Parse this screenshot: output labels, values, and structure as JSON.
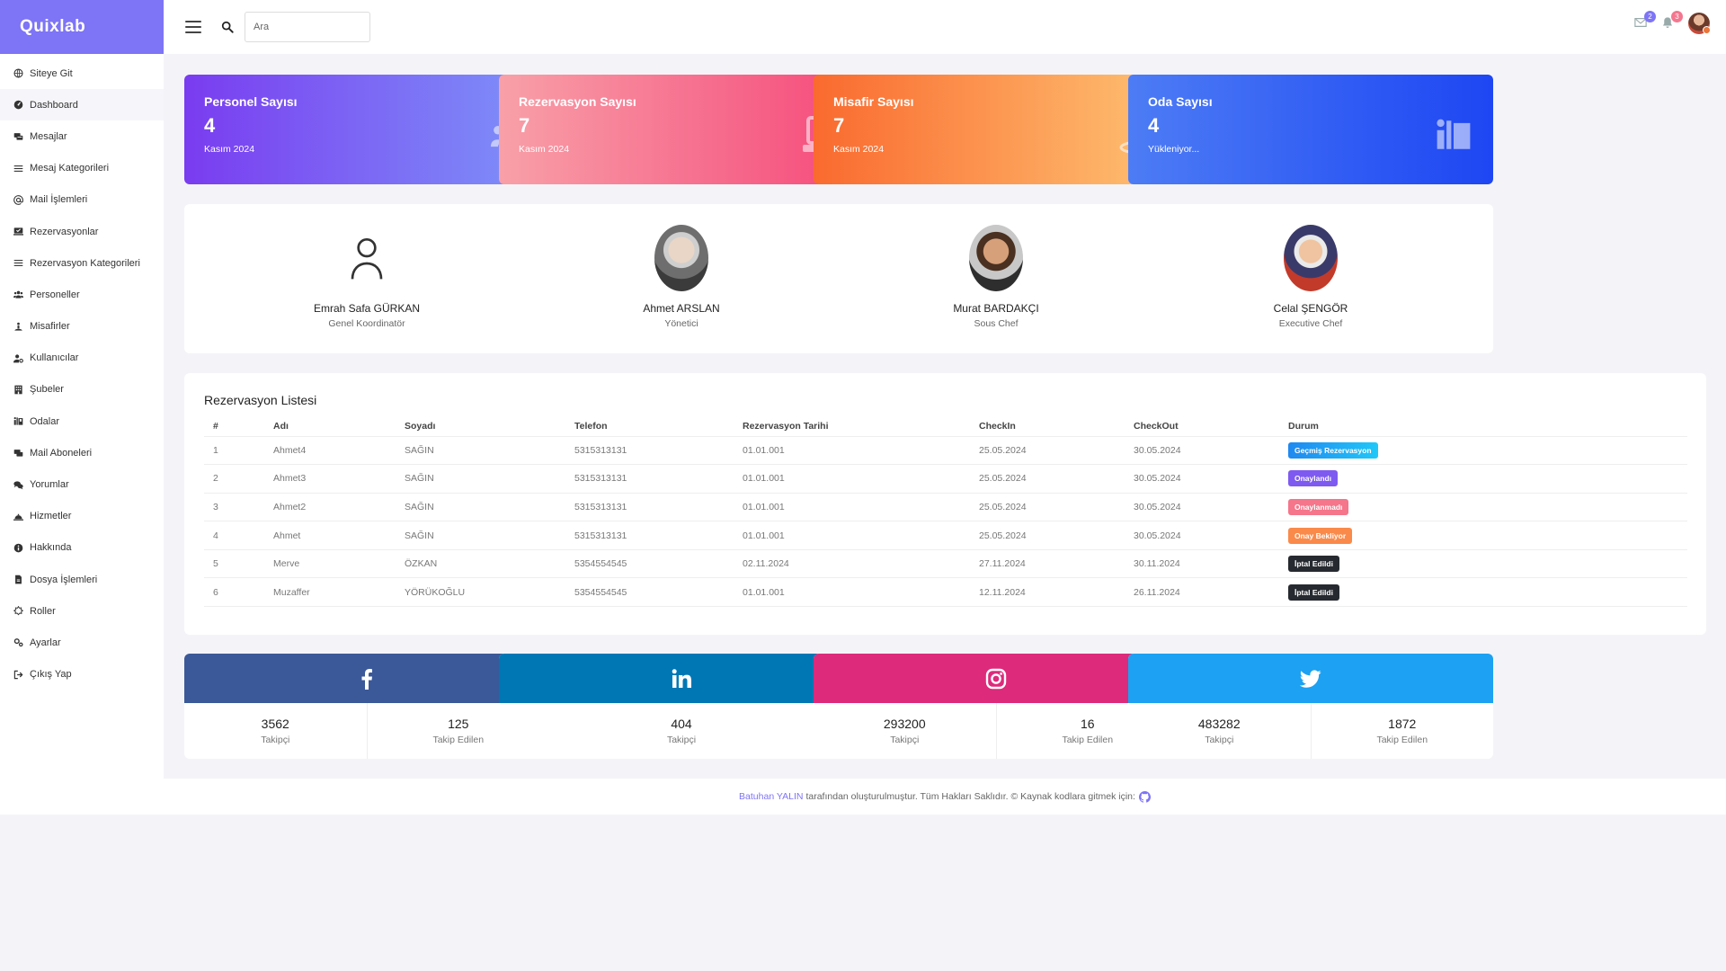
{
  "brand": "Quixlab",
  "search": {
    "placeholder": "Ara"
  },
  "header": {
    "mail_badge": "2",
    "notif_badge": "3",
    "colors": {
      "mail_badge": "#7e74f6",
      "notif_badge": "#f4778f"
    }
  },
  "sidebar": {
    "items": [
      {
        "label": "Siteye Git",
        "icon": "globe-icon"
      },
      {
        "label": "Dashboard",
        "icon": "dashboard-icon"
      },
      {
        "label": "Mesajlar",
        "icon": "messages-icon"
      },
      {
        "label": "Mesaj Kategorileri",
        "icon": "list-icon"
      },
      {
        "label": "Mail İşlemleri",
        "icon": "at-icon"
      },
      {
        "label": "Rezervasyonlar",
        "icon": "reservation-icon"
      },
      {
        "label": "Rezervasyon Kategorileri",
        "icon": "list-icon"
      },
      {
        "label": "Personeller",
        "icon": "users-icon"
      },
      {
        "label": "Misafirler",
        "icon": "guest-icon"
      },
      {
        "label": "Kullanıcılar",
        "icon": "user-cog-icon"
      },
      {
        "label": "Şubeler",
        "icon": "building-icon"
      },
      {
        "label": "Odalar",
        "icon": "room-icon"
      },
      {
        "label": "Mail Aboneleri",
        "icon": "subscribers-icon"
      },
      {
        "label": "Yorumlar",
        "icon": "comments-icon"
      },
      {
        "label": "Hizmetler",
        "icon": "services-icon"
      },
      {
        "label": "Hakkında",
        "icon": "info-icon"
      },
      {
        "label": "Dosya İşlemleri",
        "icon": "file-icon"
      },
      {
        "label": "Roller",
        "icon": "roles-icon"
      },
      {
        "label": "Ayarlar",
        "icon": "cogs-icon"
      },
      {
        "label": "Çıkış Yap",
        "icon": "logout-icon"
      }
    ],
    "active_index": 1
  },
  "stats": [
    {
      "title": "Personel Sayısı",
      "value": "4",
      "sub": "Kasım 2024",
      "icon": "users-icon",
      "gradient": [
        "#7a3cf0",
        "#7e94f9"
      ]
    },
    {
      "title": "Rezervasyon Sayısı",
      "value": "7",
      "sub": "Kasım 2024",
      "icon": "calendar-check-icon",
      "gradient": [
        "#f8a0a8",
        "#f5487a"
      ]
    },
    {
      "title": "Misafir Sayısı",
      "value": "7",
      "sub": "Kasım 2024",
      "icon": "person-stand-icon",
      "gradient": [
        "#fa6a2f",
        "#fec474"
      ]
    },
    {
      "title": "Oda Sayısı",
      "value": "4",
      "sub": "Yükleniyor...",
      "icon": "room-icon",
      "gradient": [
        "#4d7cf5",
        "#1e46f3"
      ]
    }
  ],
  "staff": [
    {
      "name": "Emrah Safa GÜRKAN",
      "role": "Genel Koordinatör",
      "photo": "placeholder-avatar-icon"
    },
    {
      "name": "Ahmet ARSLAN",
      "role": "Yönetici",
      "photo": "photo"
    },
    {
      "name": "Murat BARDAKÇI",
      "role": "Sous Chef",
      "photo": "photo"
    },
    {
      "name": "Celal ŞENGÖR",
      "role": "Executive Chef",
      "photo": "photo"
    }
  ],
  "reservations": {
    "title": "Rezervasyon Listesi",
    "columns": [
      "#",
      "Adı",
      "Soyadı",
      "Telefon",
      "Rezervasyon Tarihi",
      "CheckIn",
      "CheckOut",
      "Durum"
    ],
    "rows": [
      {
        "no": "1",
        "name": "Ahmet4",
        "surname": "SAĞIN",
        "phone": "5315313131",
        "date": "01.01.001",
        "checkin": "25.05.2024",
        "checkout": "30.05.2024",
        "status": "Geçmiş Rezervasyon",
        "status_color": "#20a5f0"
      },
      {
        "no": "2",
        "name": "Ahmet3",
        "surname": "SAĞIN",
        "phone": "5315313131",
        "date": "01.01.001",
        "checkin": "25.05.2024",
        "checkout": "30.05.2024",
        "status": "Onaylandı",
        "status_color": "#7e5af0"
      },
      {
        "no": "3",
        "name": "Ahmet2",
        "surname": "SAĞIN",
        "phone": "5315313131",
        "date": "01.01.001",
        "checkin": "25.05.2024",
        "checkout": "30.05.2024",
        "status": "Onaylanmadı",
        "status_color": "#f5758a"
      },
      {
        "no": "4",
        "name": "Ahmet",
        "surname": "SAĞIN",
        "phone": "5315313131",
        "date": "01.01.001",
        "checkin": "25.05.2024",
        "checkout": "30.05.2024",
        "status": "Onay Bekliyor",
        "status_color": "#fa8a4a"
      },
      {
        "no": "5",
        "name": "Merve",
        "surname": "ÖZKAN",
        "phone": "5354554545",
        "date": "02.11.2024",
        "checkin": "27.11.2024",
        "checkout": "30.11.2024",
        "status": "İptal Edildi",
        "status_color": "#262a30"
      },
      {
        "no": "6",
        "name": "Muzaffer",
        "surname": "YÖRÜKOĞLU",
        "phone": "5354554545",
        "date": "01.01.001",
        "checkin": "12.11.2024",
        "checkout": "26.11.2024",
        "status": "İptal Edildi",
        "status_color": "#262a30"
      }
    ]
  },
  "social": [
    {
      "network": "facebook",
      "icon": "facebook-icon",
      "color": "#3b5998",
      "stats": [
        {
          "num": "3562",
          "label": "Takipçi"
        },
        {
          "num": "125",
          "label": "Takip Edilen"
        }
      ]
    },
    {
      "network": "linkedin",
      "icon": "linkedin-icon",
      "color": "#0077b5",
      "stats": [
        {
          "num": "404",
          "label": "Takipçi"
        }
      ]
    },
    {
      "network": "instagram",
      "icon": "instagram-icon",
      "color": "#dd2a7b",
      "stats": [
        {
          "num": "293200",
          "label": "Takipçi"
        },
        {
          "num": "16",
          "label": "Takip Edilen"
        }
      ]
    },
    {
      "network": "twitter",
      "icon": "twitter-icon",
      "color": "#1da1f2",
      "stats": [
        {
          "num": "483282",
          "label": "Takipçi"
        },
        {
          "num": "1872",
          "label": "Takip Edilen"
        }
      ]
    }
  ],
  "footer": {
    "author": "Batuhan YALIN",
    "text": "tarafından oluşturulmuştur. Tüm Hakları Saklıdır. © Kaynak kodlara gitmek için:",
    "icon": "github-icon"
  }
}
